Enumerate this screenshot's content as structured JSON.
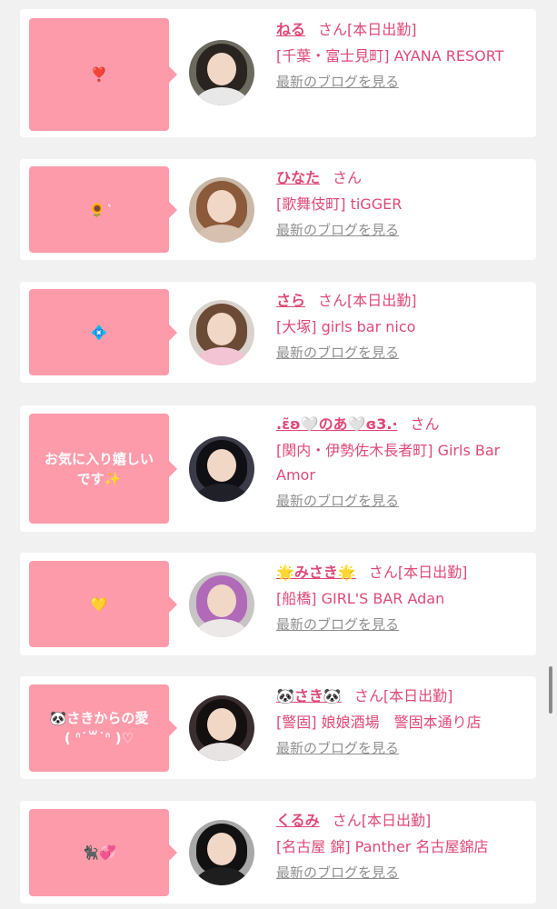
{
  "cards": [
    {
      "bubble_text": "❣️",
      "name": "ねる",
      "honorific": "さん",
      "status": "[本日出勤]",
      "shop": "[千葉・富士見町] AYANA RESORT",
      "blog_link": "最新のブログを見る",
      "avatar_colors": {
        "bg": "#6b6a5e",
        "hair": "#2a2420",
        "body": "#e8e8e8"
      }
    },
    {
      "bubble_text": "🌻 ͛ ",
      "name": "ひなた",
      "honorific": "さん",
      "status": "",
      "shop": "[歌舞伎町] tiGGER",
      "blog_link": "最新のブログを見る",
      "avatar_colors": {
        "bg": "#c9b8a6",
        "hair": "#8a5a3a",
        "body": "#d8c0b0"
      }
    },
    {
      "bubble_text": "💠",
      "name": "さら",
      "honorific": "さん",
      "status": "[本日出勤]",
      "shop": "[大塚] girls bar nico",
      "blog_link": "最新のブログを見る",
      "avatar_colors": {
        "bg": "#d9d2cc",
        "hair": "#6b4a36",
        "body": "#f3c4d4"
      }
    },
    {
      "bubble_text": "お気に入り嬉しい\nです✨",
      "name": ".ɛ̃ʚ🤍のあ🤍ɞ3.·",
      "honorific": "さん",
      "status": "",
      "shop": "[関内・伊勢佐木長者町] Girls Bar Amor",
      "blog_link": "最新のブログを見る",
      "avatar_colors": {
        "bg": "#3a3a48",
        "hair": "#101014",
        "body": "#202028"
      }
    },
    {
      "bubble_text": "💛",
      "name": "🌟みさき🌟",
      "honorific": "さん",
      "status": "[本日出勤]",
      "shop": "[船橋] GIRL'S BAR Adan",
      "blog_link": "最新のブログを見る",
      "avatar_colors": {
        "bg": "#c8c4c6",
        "hair": "#b06ab8",
        "body": "#ece8e8"
      }
    },
    {
      "bubble_text": "🐼さきからの愛\n( ᐢ˙꒳˙ᐢ )♡",
      "name": "🐼さき🐼",
      "honorific": "さん",
      "status": "[本日出勤]",
      "shop": "[警固] 娘娘酒場　警固本通り店",
      "blog_link": "最新のブログを見る",
      "avatar_colors": {
        "bg": "#3a2e30",
        "hair": "#141010",
        "body": "#e8e4e4"
      }
    },
    {
      "bubble_text": "🐈‍⬛💞",
      "name": "くるみ",
      "honorific": "さん",
      "status": "[本日出勤]",
      "shop": "[名古屋 錦] Panther 名古屋錦店",
      "blog_link": "最新のブログを見る",
      "avatar_colors": {
        "bg": "#a8a8a8",
        "hair": "#111111",
        "body": "#1e1e1e"
      }
    }
  ],
  "colors": {
    "bubble": "#fd9bab",
    "accent": "#dd4a77",
    "link_gray": "#8f8f8f",
    "background": "#f1f1f1"
  }
}
